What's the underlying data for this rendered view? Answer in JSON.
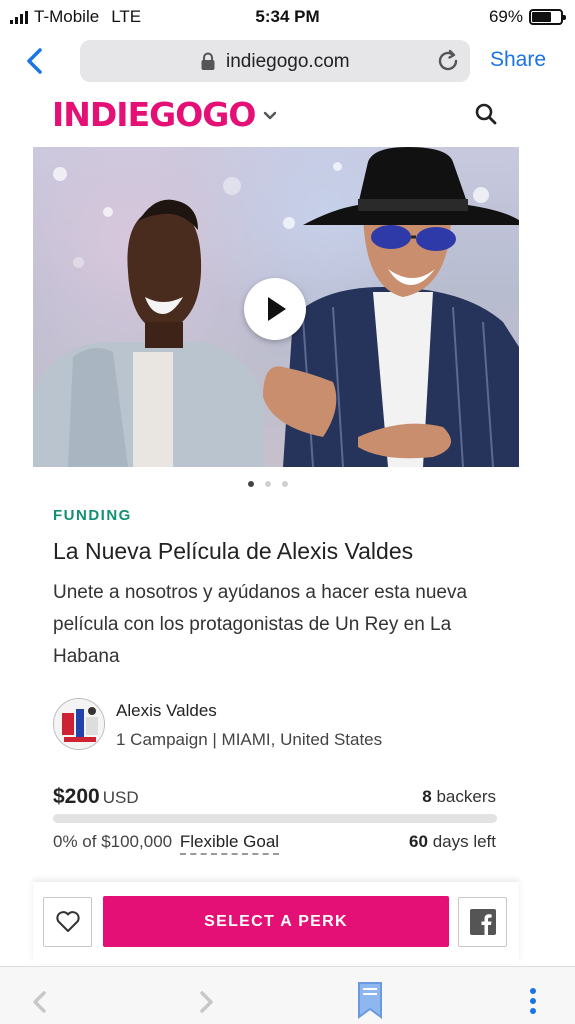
{
  "status_bar": {
    "carrier": "T-Mobile",
    "network": "LTE",
    "time": "5:34 PM",
    "battery_percent": "69%",
    "battery_level": 0.69
  },
  "browser": {
    "domain": "indiegogo.com",
    "share_label": "Share"
  },
  "header": {
    "logo": "INDIEGOGO"
  },
  "hero": {
    "media_count": 3,
    "active_index": 0
  },
  "campaign": {
    "eyebrow": "FUNDING",
    "title": "La Nueva Película de Alexis Valdes",
    "tagline": "Unete a nosotros y ayúdanos a hacer esta nueva película con los protagonistas de Un Rey en La Habana",
    "owner_name": "Alexis Valdes",
    "owner_meta": "1 Campaign | MIAMI, United States",
    "raised_amount": "$200",
    "raised_currency": "USD",
    "backers_count": "8",
    "backers_label": "backers",
    "progress_percent": 0,
    "goal_prefix": "0% of $100,000",
    "goal_type": "Flexible Goal",
    "days_count": "60",
    "days_label": "days left"
  },
  "actions": {
    "perk_label": "SELECT A PERK"
  },
  "colors": {
    "brand": "#e51075",
    "link": "#1a73e8",
    "eyebrow": "#128f74"
  }
}
